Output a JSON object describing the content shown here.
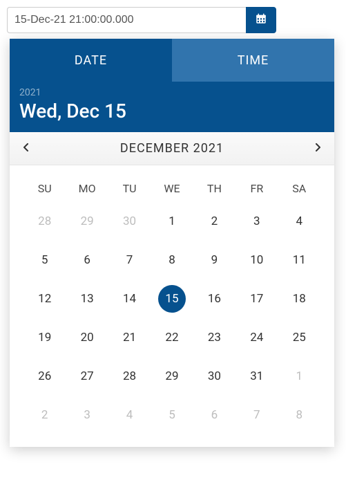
{
  "input": {
    "value": "15-Dec-21 21:00:00.000"
  },
  "tabs": {
    "date": "DATE",
    "time": "TIME"
  },
  "header": {
    "year": "2021",
    "date_str": "Wed, Dec 15"
  },
  "nav": {
    "month_label": "DECEMBER 2021",
    "prev": "‹",
    "next": "›"
  },
  "weekdays": [
    "SU",
    "MO",
    "TU",
    "WE",
    "TH",
    "FR",
    "SA"
  ],
  "weeks": [
    [
      {
        "n": "28",
        "other": true
      },
      {
        "n": "29",
        "other": true
      },
      {
        "n": "30",
        "other": true
      },
      {
        "n": "1"
      },
      {
        "n": "2"
      },
      {
        "n": "3"
      },
      {
        "n": "4"
      }
    ],
    [
      {
        "n": "5"
      },
      {
        "n": "6"
      },
      {
        "n": "7"
      },
      {
        "n": "8"
      },
      {
        "n": "9"
      },
      {
        "n": "10"
      },
      {
        "n": "11"
      }
    ],
    [
      {
        "n": "12"
      },
      {
        "n": "13"
      },
      {
        "n": "14"
      },
      {
        "n": "15",
        "selected": true
      },
      {
        "n": "16"
      },
      {
        "n": "17"
      },
      {
        "n": "18"
      }
    ],
    [
      {
        "n": "19"
      },
      {
        "n": "20"
      },
      {
        "n": "21"
      },
      {
        "n": "22"
      },
      {
        "n": "23"
      },
      {
        "n": "24"
      },
      {
        "n": "25"
      }
    ],
    [
      {
        "n": "26"
      },
      {
        "n": "27"
      },
      {
        "n": "28"
      },
      {
        "n": "29"
      },
      {
        "n": "30"
      },
      {
        "n": "31"
      },
      {
        "n": "1",
        "other": true
      }
    ],
    [
      {
        "n": "2",
        "other": true
      },
      {
        "n": "3",
        "other": true
      },
      {
        "n": "4",
        "other": true
      },
      {
        "n": "5",
        "other": true
      },
      {
        "n": "6",
        "other": true
      },
      {
        "n": "7",
        "other": true
      },
      {
        "n": "8",
        "other": true
      }
    ]
  ]
}
